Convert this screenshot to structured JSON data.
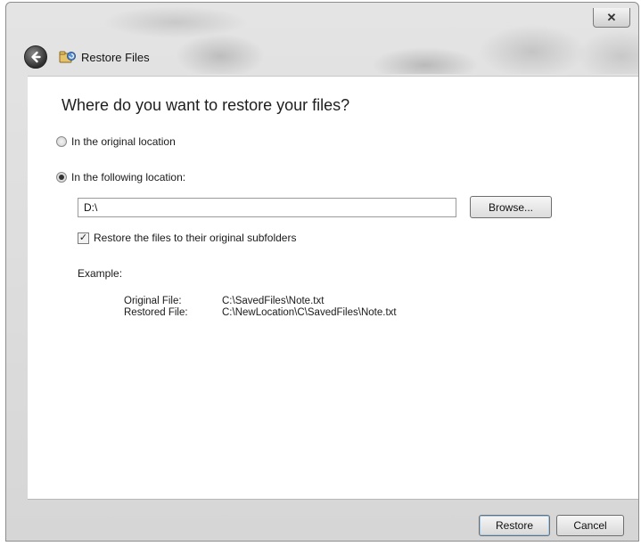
{
  "window": {
    "close_glyph": "✕"
  },
  "nav": {
    "back_icon": "back-arrow-icon",
    "app_icon": "restore-files-icon",
    "title": "Restore Files"
  },
  "main": {
    "heading": "Where do you want to restore your files?",
    "options": [
      {
        "label": "In the original location",
        "selected": false
      },
      {
        "label": "In the following location:",
        "selected": true
      }
    ],
    "location_value": "D:\\",
    "browse_label": "Browse...",
    "subfolders_checked": true,
    "subfolders_label": "Restore the files to their original subfolders",
    "example": {
      "label": "Example:",
      "original_label": "Original File:",
      "original_value": "C:\\SavedFiles\\Note.txt",
      "restored_label": "Restored File:",
      "restored_value": "C:\\NewLocation\\C\\SavedFiles\\Note.txt"
    }
  },
  "footer": {
    "restore_label": "Restore",
    "cancel_label": "Cancel"
  }
}
